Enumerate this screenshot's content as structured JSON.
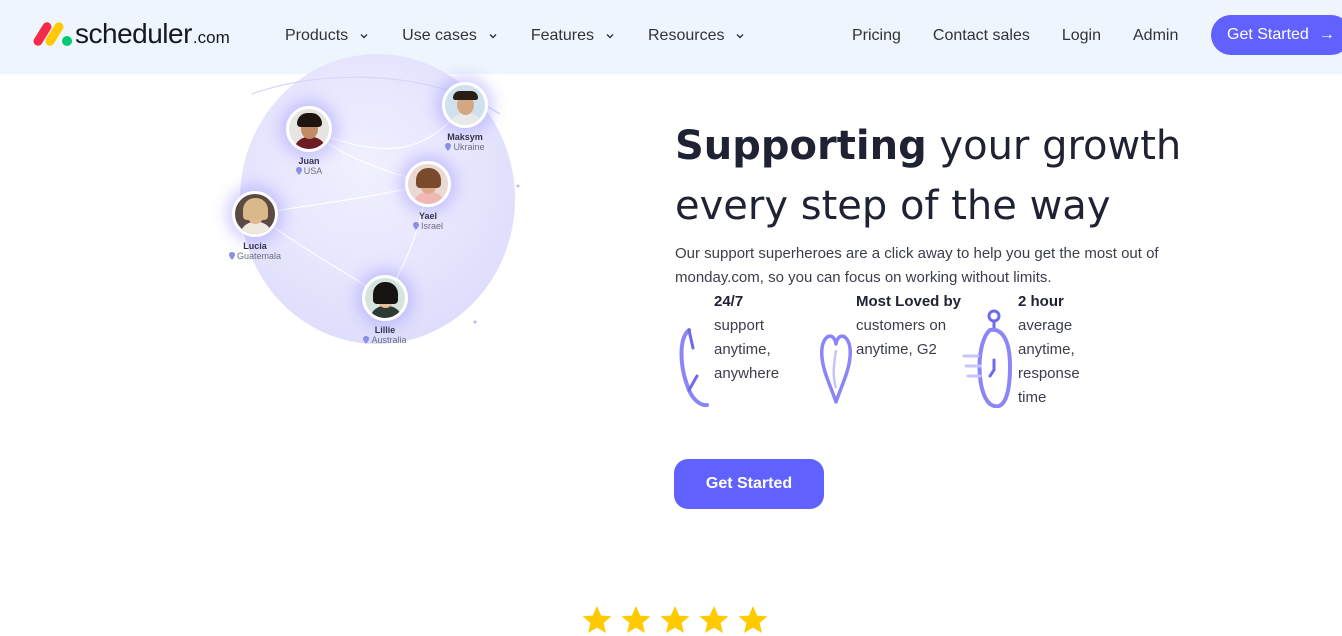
{
  "brand": {
    "name": "scheduler",
    "suffix": ".com"
  },
  "nav": {
    "items": [
      {
        "label": "Products"
      },
      {
        "label": "Use cases"
      },
      {
        "label": "Features"
      },
      {
        "label": "Resources"
      }
    ],
    "links": {
      "pricing": "Pricing",
      "contact": "Contact sales",
      "login": "Login",
      "admin": "Admin"
    },
    "cta": {
      "label": "Get Started",
      "icon": "arrow-right-icon"
    }
  },
  "team": [
    {
      "name": "Maksym",
      "location": "Ukraine"
    },
    {
      "name": "Juan",
      "location": "USA"
    },
    {
      "name": "Yael",
      "location": "Israel"
    },
    {
      "name": "Lucia",
      "location": "Guatemala"
    },
    {
      "name": "Lillie",
      "location": "Australia"
    }
  ],
  "hero": {
    "title_bold": "Supporting",
    "title_rest_line1": " your growth",
    "title_line2": "every step of the way",
    "description": "Our support superheroes are a click away to help you get the most out of monday.com, so you can focus on working without limits.",
    "features": [
      {
        "title": "24/7",
        "desc": "support anytime, anywhere",
        "icon": "phone-icon"
      },
      {
        "title": "Most Loved by",
        "desc": "customers on anytime, G2",
        "icon": "heart-icon"
      },
      {
        "title": "2 hour",
        "desc": "average anytime, response time",
        "icon": "stopwatch-icon"
      }
    ],
    "cta_label": "Get Started"
  },
  "rating": {
    "stars": 5,
    "star_color": "#ffcb00"
  },
  "colors": {
    "accent": "#6161ff",
    "nav_bg": "#eef5fd"
  }
}
